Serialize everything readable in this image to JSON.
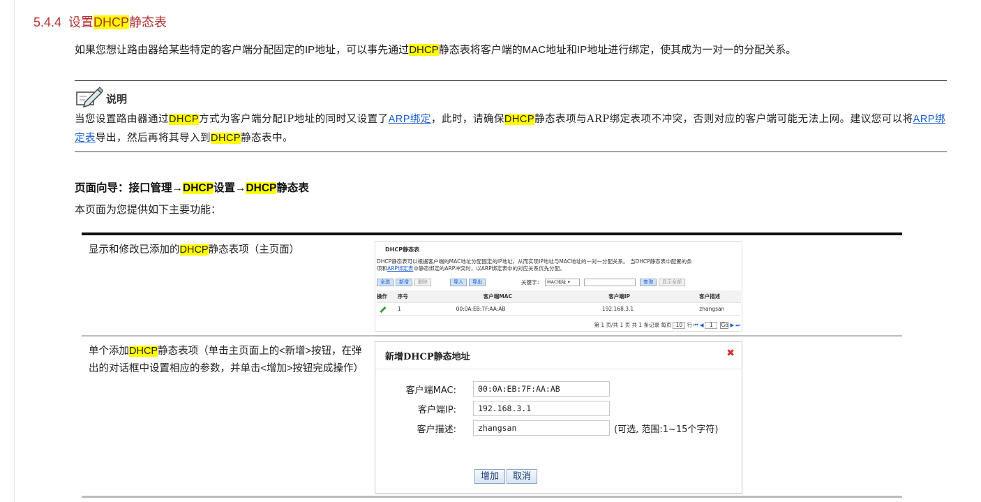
{
  "section": {
    "number": "5.4.4",
    "title_pre": "设置",
    "title_hl": "DHCP",
    "title_post": "静态表"
  },
  "intro": {
    "part1": "如果您想让路由器给某些特定的客户端分配固定的IP地址，可以事先通过",
    "hl": "DHCP",
    "part2": "静态表将客户端的MAC地址和IP地址进行绑定，使其成为一对一的分配关系。"
  },
  "note": {
    "label": "说明",
    "t1": "当您设置路由器通过",
    "hl1": "DHCP",
    "t2": "方式为客户端分配IP地址的同时又设置了",
    "link1": "ARP绑定",
    "t3": "，此时，请确保",
    "hl2": "DHCP",
    "t4": "静态表项与ARP绑定表项不冲突，否则对应的客户端可能无法上网。建议您可以将",
    "link2": "ARP绑定表",
    "t5": "导出，然后再将其导入到",
    "hl3": "DHCP",
    "t6": "静态表中。"
  },
  "nav": {
    "prefix": "页面向导：接口管理→",
    "hl1": "DHCP",
    "mid": "设置→",
    "hl2": "DHCP",
    "suffix": "静态表"
  },
  "page_intro": "本页面为您提供如下主要功能：",
  "rows": [
    {
      "pre": "显示和修改已添加的",
      "hl": "DHCP",
      "post": "静态表项（主页面）"
    },
    {
      "pre": "单个添加",
      "hl": "DHCP",
      "post": "静态表项（单击主页面上的<新增>按钮，在弹出的对话框中设置相应的参数，并单击<增加>按钮完成操作）"
    }
  ],
  "shot1": {
    "title": "DHCP静态表",
    "desc1": "DHCP静态表可以根据客户端的MAC地址分配固定的IP地址，从而实现IP地址与MAC地址的一对一分配关系。   当DHCP静态表中配置的条",
    "desc2_pre": "项和",
    "desc2_link": "ARP绑定表",
    "desc2_post": "中静态绑定的ARP冲突时，以ARP绑定表中的对应关系优先分配。",
    "buttons": {
      "select_all": "全选",
      "add": "新增",
      "delete": "删除",
      "import": "导入",
      "export": "导出",
      "search": "查询",
      "show_all": "显示全部"
    },
    "keyword_label": "关键字：",
    "keyword_option": "MAC地址",
    "headers": [
      "操作",
      "序号",
      "客户端MAC",
      "客户端IP",
      "客户描述"
    ],
    "row": {
      "index": "1",
      "mac": "00:0A:EB:7F:AA:AB",
      "ip": "192.168.3.1",
      "desc": "zhangsan"
    },
    "pager": {
      "text": "第 1 页/共 1 页 共 1 条记录 每页",
      "per_page": "10",
      "rows_label": "行",
      "page": "1",
      "go": "Go"
    }
  },
  "dialog": {
    "title": "新增DHCP静态地址",
    "mac_label": "客户端MAC:",
    "mac_value": "00:0A:EB:7F:AA:AB",
    "ip_label": "客户端IP:",
    "ip_value": "192.168.3.1",
    "desc_label": "客户描述:",
    "desc_value": "zhangsan",
    "desc_hint": "(可选, 范围:1~15个字符)",
    "add_button": "增加",
    "cancel_button": "取消"
  },
  "colors": {
    "highlight": "#ffff00",
    "section_title": "#b03030",
    "link": "#1a5fd0",
    "close": "#d03030"
  }
}
